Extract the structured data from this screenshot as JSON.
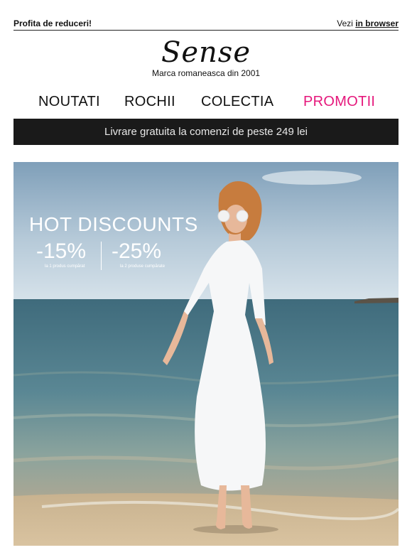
{
  "header": {
    "promo_text": "Profita de reduceri!",
    "view_prefix": "Vezi",
    "view_link": "in browser"
  },
  "brand": {
    "logo": "Sense",
    "tagline": "Marca romaneasca din 2001"
  },
  "nav": {
    "items": [
      "NOUTATI",
      "ROCHII",
      "COLECTIA",
      "PROMOTII"
    ],
    "highlight_color": "#e5177b"
  },
  "banner": {
    "text": "Livrare gratuita la comenzi de peste 249 lei"
  },
  "hero": {
    "title": "HOT DISCOUNTS",
    "deals": [
      {
        "percent": "-15%",
        "note": "la 1 produs cumpărat"
      },
      {
        "percent": "-25%",
        "note": "la 2 produse cumpărate"
      }
    ]
  }
}
